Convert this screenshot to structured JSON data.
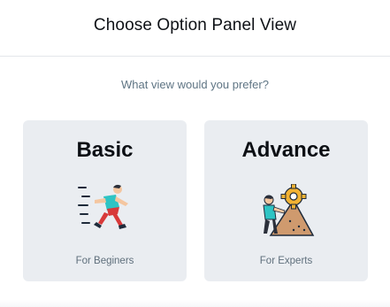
{
  "dialog": {
    "title": "Choose Option Panel View",
    "prompt": "What view would you prefer?"
  },
  "options": [
    {
      "title": "Basic",
      "subtitle": "For Beginers",
      "icon": "running-person-icon"
    },
    {
      "title": "Advance",
      "subtitle": "For Experts",
      "icon": "climber-gear-icon"
    }
  ],
  "colors": {
    "card_background": "#eaedf1",
    "prompt_text": "#5f7584",
    "divider": "#e3e6ea"
  }
}
